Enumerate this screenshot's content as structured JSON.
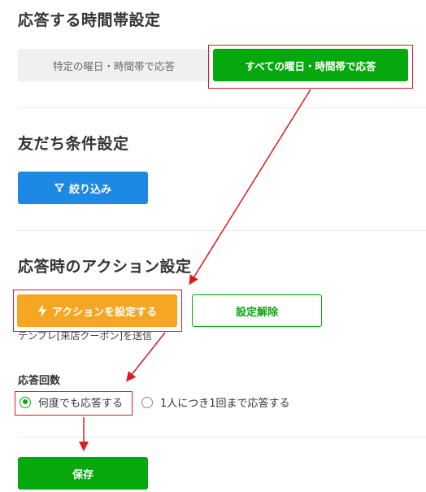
{
  "sections": {
    "response_time_title": "応答する時間帯設定",
    "friend_condition_title": "友だち条件設定",
    "action_title": "応答時のアクション設定"
  },
  "time_toggle": {
    "specific_label": "特定の曜日・時間帯で応答",
    "all_label": "すべての曜日・時間帯で応答"
  },
  "filter_button": {
    "label": "絞り込み",
    "icon": "filter-icon"
  },
  "action_button": {
    "label": "アクションを設定する",
    "icon": "lightning-icon"
  },
  "clear_button": {
    "label": "設定解除"
  },
  "action_summary": "テンプレ[来店クーポン]を送信",
  "response_count": {
    "label": "応答回数",
    "options": [
      {
        "label": "何度でも応答する",
        "selected": true
      },
      {
        "label": "1人につき1回まで応答する",
        "selected": false
      }
    ]
  },
  "save_button": {
    "label": "保存"
  },
  "colors": {
    "primary_green": "#06a80e",
    "filter_blue": "#1e88e5",
    "action_orange": "#f6a623",
    "annotation_red": "#e01a1a"
  }
}
